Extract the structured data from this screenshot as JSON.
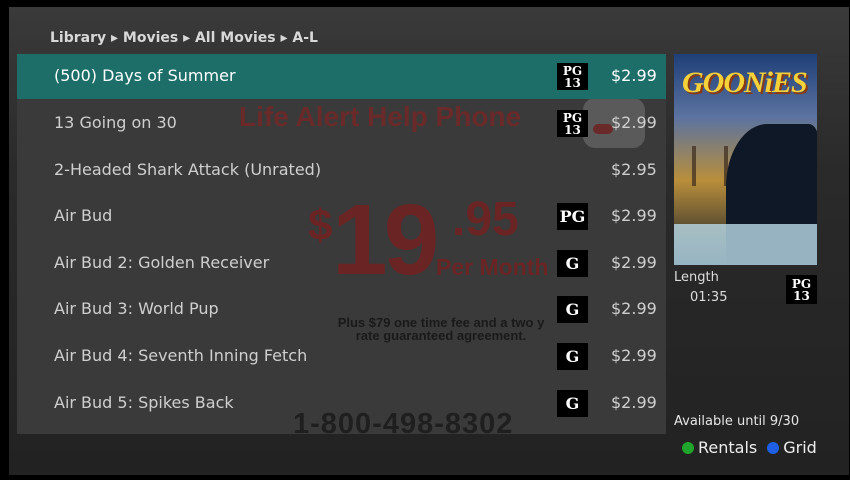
{
  "breadcrumb": "Library ▸ Movies ▸ All Movies ▸ A-L",
  "movies": [
    {
      "title": "(500) Days of Summer",
      "rating_top": "PG",
      "rating_bottom": "13",
      "price": "$2.99"
    },
    {
      "title": "13 Going on 30",
      "rating_top": "PG",
      "rating_bottom": "13",
      "price": "$2.99"
    },
    {
      "title": "2-Headed Shark Attack (Unrated)",
      "rating_top": "",
      "rating_bottom": "",
      "price": "$2.95"
    },
    {
      "title": "Air Bud",
      "rating_top": "PG",
      "rating_bottom": "",
      "price": "$2.99"
    },
    {
      "title": "Air Bud 2: Golden Receiver",
      "rating_top": "G",
      "rating_bottom": "",
      "price": "$2.99"
    },
    {
      "title": "Air Bud 3: World Pup",
      "rating_top": "G",
      "rating_bottom": "",
      "price": "$2.99"
    },
    {
      "title": "Air Bud 4: Seventh Inning Fetch",
      "rating_top": "G",
      "rating_bottom": "",
      "price": "$2.99"
    },
    {
      "title": "Air Bud 5: Spikes Back",
      "rating_top": "G",
      "rating_bottom": "",
      "price": "$2.99"
    }
  ],
  "ad": {
    "headline": "Life Alert Help Phone",
    "price_dollar": "$",
    "price_main": "19",
    "price_cents": ".95",
    "price_per": "Per Month",
    "fee_line1": "Plus $79 one time fee and a two y",
    "fee_line2": "rate guaranteed agreement.",
    "phone": "1-800-498-8302"
  },
  "details": {
    "poster_title": "GOONiES",
    "length_label": "Length",
    "length_value": "01:35",
    "rating_top": "PG",
    "rating_bottom": "13",
    "available": "Available until 9/30"
  },
  "buttons": [
    {
      "label": "Rentals",
      "color": "#1fa52b"
    },
    {
      "label": "Grid",
      "color": "#1f5fe6"
    }
  ],
  "colors": {
    "selection": "#1d6e68"
  }
}
